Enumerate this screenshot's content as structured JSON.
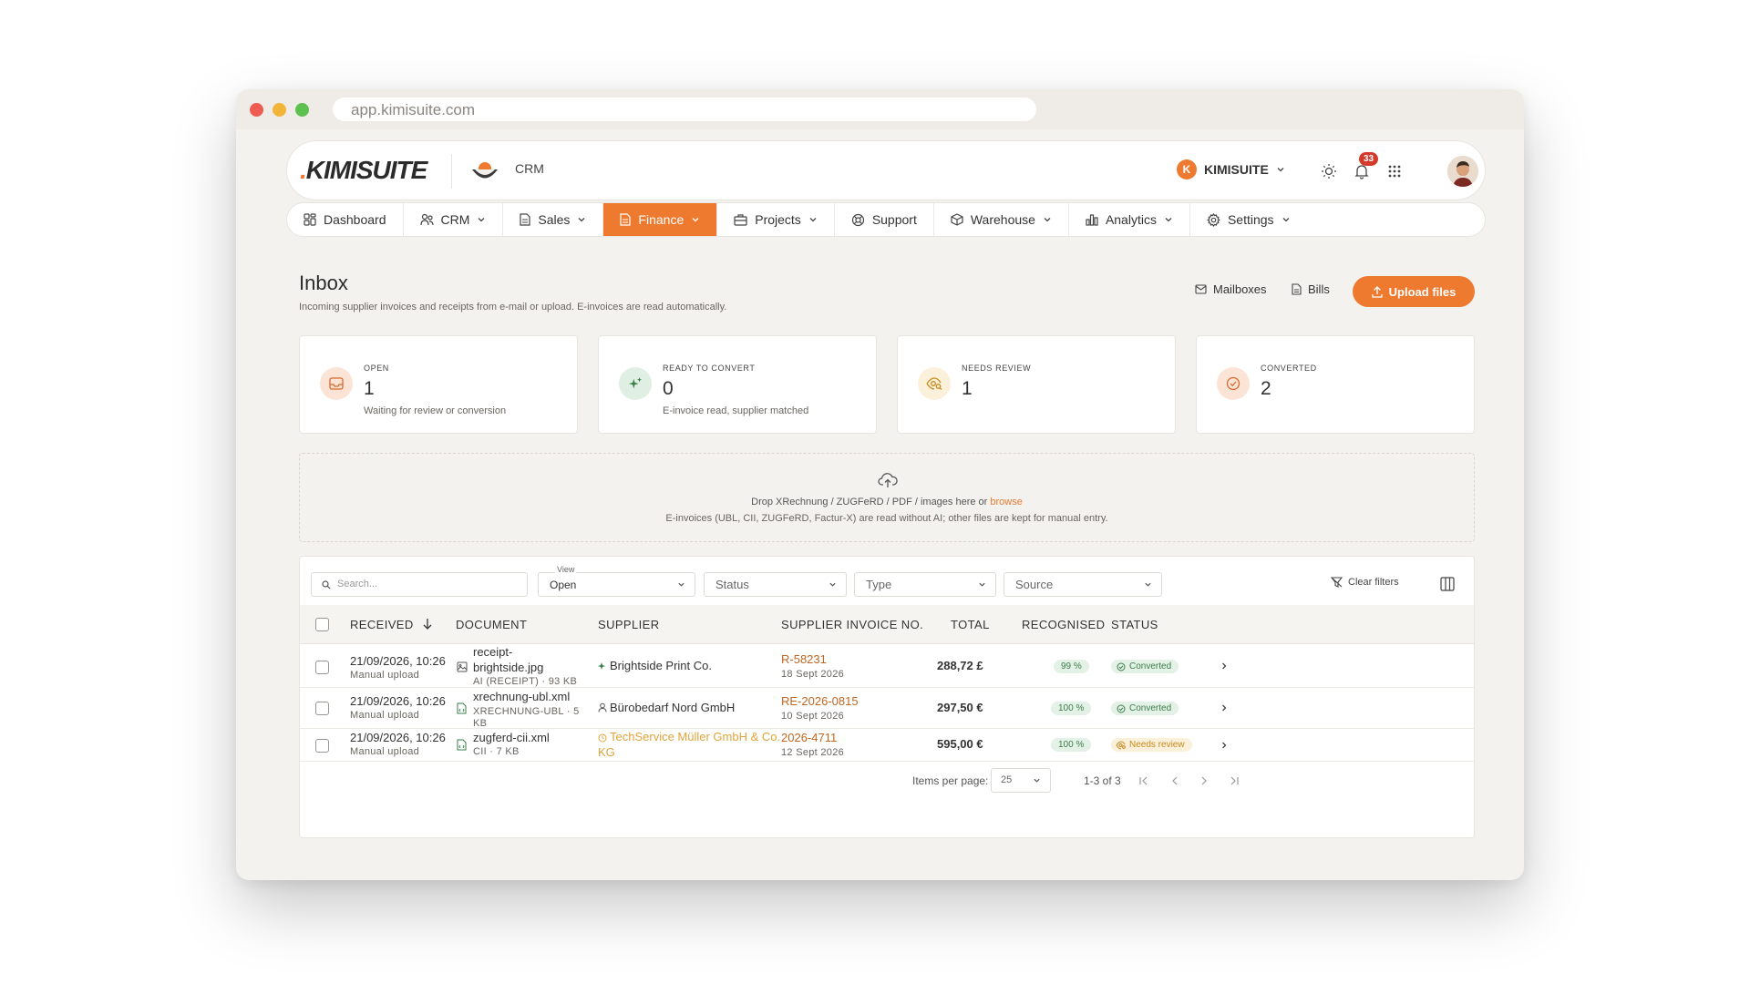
{
  "browser": {
    "url": "app.kimisuite.com"
  },
  "header": {
    "logo_dot": ".",
    "logo_text": "KIMISUITE",
    "app_name": "CRM",
    "workspace_initial": "K",
    "workspace_name": "KIMISUITE",
    "notification_count": "33"
  },
  "nav": [
    {
      "label": "Dashboard",
      "icon": "dashboard-icon"
    },
    {
      "label": "CRM",
      "icon": "users-icon"
    },
    {
      "label": "Sales",
      "icon": "document-icon"
    },
    {
      "label": "Finance",
      "icon": "document-icon",
      "active": true
    },
    {
      "label": "Projects",
      "icon": "briefcase-icon"
    },
    {
      "label": "Support",
      "icon": "lifebuoy-icon"
    },
    {
      "label": "Warehouse",
      "icon": "box-icon"
    },
    {
      "label": "Analytics",
      "icon": "bar-chart-icon"
    },
    {
      "label": "Settings",
      "icon": "gear-icon"
    }
  ],
  "page": {
    "title": "Inbox",
    "subtitle": "Incoming supplier invoices and receipts from e-mail or upload. E-invoices are read automatically.",
    "mailboxes_label": "Mailboxes",
    "bills_label": "Bills",
    "upload_label": "Upload files"
  },
  "stats": [
    {
      "label": "OPEN",
      "value": "1",
      "desc": "Waiting for review or conversion"
    },
    {
      "label": "READY TO CONVERT",
      "value": "0",
      "desc": "E-invoice read, supplier matched"
    },
    {
      "label": "NEEDS REVIEW",
      "value": "1",
      "desc": ""
    },
    {
      "label": "CONVERTED",
      "value": "2",
      "desc": ""
    }
  ],
  "dropzone": {
    "line1": "Drop XRechnung / ZUGFeRD / PDF / images here or",
    "browse": "browse",
    "line2": "E-invoices (UBL, CII, ZUGFeRD, Factur-X) are read without AI; other files are kept for manual entry."
  },
  "filters": {
    "search_placeholder": "Search...",
    "view_label": "View",
    "view_value": "Open",
    "status": "Status",
    "type": "Type",
    "source": "Source",
    "clear": "Clear filters"
  },
  "table": {
    "headers": {
      "received": "RECEIVED",
      "document": "DOCUMENT",
      "supplier": "SUPPLIER",
      "invoice_no": "SUPPLIER INVOICE NO.",
      "total": "TOTAL",
      "recognised": "RECOGNISED",
      "status": "STATUS"
    },
    "rows": [
      {
        "received": "21/09/2026, 10:26",
        "source": "Manual upload",
        "doc_name_1": "receipt-",
        "doc_name_2": "brightside.jpg",
        "doc_meta": "AI (RECEIPT) · 93 KB",
        "supplier": "Brightside Print Co.",
        "invoice_no": "R-58231",
        "invoice_date": "18 Sept 2026",
        "total": "288,72 £",
        "recognised": "99 %",
        "status": "Converted"
      },
      {
        "received": "21/09/2026, 10:26",
        "source": "Manual upload",
        "doc_name_1": "xrechnung-ubl.xml",
        "doc_meta_1": "XRECHNUNG-UBL · 5",
        "doc_meta_2": "KB",
        "supplier": "Bürobedarf Nord GmbH",
        "invoice_no": "RE-2026-0815",
        "invoice_date": "10 Sept 2026",
        "total": "297,50 €",
        "recognised": "100 %",
        "status": "Converted"
      },
      {
        "received": "21/09/2026, 10:26",
        "source": "Manual upload",
        "doc_name_1": "zugferd-cii.xml",
        "doc_meta": "CII · 7 KB",
        "supplier_1": "TechService Müller GmbH & Co.",
        "supplier_2": "KG",
        "invoice_no": "2026-4711",
        "invoice_date": "12 Sept 2026",
        "total": "595,00 €",
        "recognised": "100 %",
        "status": "Needs review"
      }
    ]
  },
  "pagination": {
    "items_per_page_label": "Items per page:",
    "items_per_page": "25",
    "range": "1-3 of 3"
  },
  "colors": {
    "accent": "#ee7a2f",
    "success": "#3b7d4b",
    "warning": "#c68a1e"
  }
}
